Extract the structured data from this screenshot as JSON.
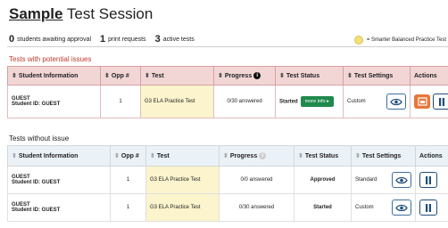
{
  "title": {
    "bold": "Sample",
    "rest": " Test Session"
  },
  "summary": {
    "awaiting_count": "0",
    "awaiting_label": "students awaiting approval",
    "print_count": "1",
    "print_label": "print requests",
    "active_count": "3",
    "active_label": "active tests"
  },
  "legend": {
    "label": "= Smarter Balanced Practice Test",
    "color": "#f3e07a"
  },
  "issues_section": {
    "heading": "Tests with potential issues",
    "columns": {
      "student": "Student Information",
      "opp": "Opp #",
      "test": "Test",
      "progress": "Progress",
      "status": "Test Status",
      "settings": "Test Settings",
      "actions": "Actions"
    },
    "rows": [
      {
        "name": "GUEST",
        "student_id": "Student ID: GUEST",
        "opp": "1",
        "test": "G3 ELA Practice Test",
        "progress": "0/30 answered",
        "status": "Started",
        "more_info": "more info ▸",
        "settings": "Custom"
      }
    ]
  },
  "ok_section": {
    "heading": "Tests without issue",
    "columns": {
      "student": "Student Information",
      "opp": "Opp #",
      "test": "Test",
      "progress": "Progress",
      "status": "Test Status",
      "settings": "Test Settings",
      "actions": "Actions"
    },
    "rows": [
      {
        "name": "GUEST",
        "student_id": "Student ID: GUEST",
        "opp": "1",
        "test": "G3 ELA Practice Test",
        "progress": "0/0 answered",
        "status": "Approved",
        "settings": "Standard"
      },
      {
        "name": "GUEST",
        "student_id": "Student ID: GUEST",
        "opp": "1",
        "test": "G3 ELA Practice Test",
        "progress": "0/30 answered",
        "status": "Started",
        "settings": "Custom"
      }
    ]
  },
  "colors": {
    "issue_header": "#f2d6d6",
    "issue_text": "#c0392b",
    "ok_header": "#eaf2f8",
    "practice_highlight": "#fbf4cc",
    "green_button": "#1f8a4c",
    "orange_button": "#e8763a"
  }
}
